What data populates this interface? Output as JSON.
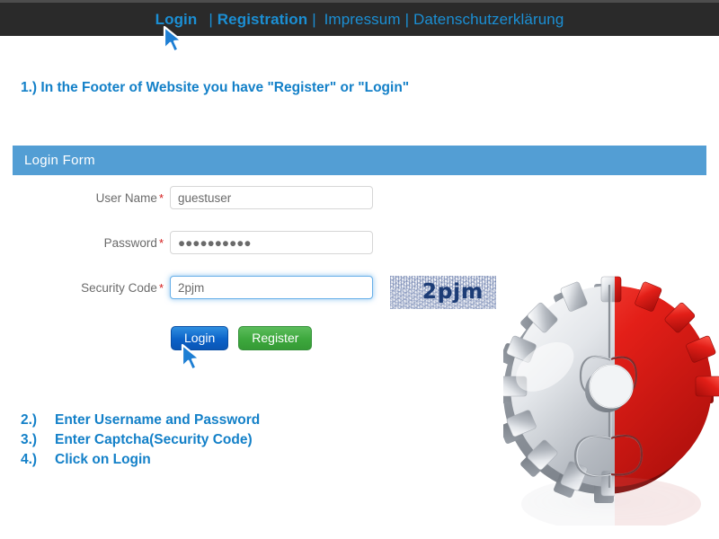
{
  "nav": {
    "items": [
      {
        "label": "Login",
        "bold": true
      },
      {
        "label": "Registration",
        "bold": true
      },
      {
        "label": "Impressum",
        "bold": false
      },
      {
        "label": "Datenschutzerklärung",
        "bold": false
      }
    ],
    "separator": "|",
    "link_color": "#1b8fd4",
    "bar_color": "#2a2a2a"
  },
  "instructions": {
    "step1": "1.) In the Footer of Website you have \"Register\" or \"Login\"",
    "steps": [
      {
        "num": "2.)",
        "text": "Enter Username and Password"
      },
      {
        "num": "3.)",
        "text": "Enter Captcha(Security Code)"
      },
      {
        "num": "4.)",
        "text": "Click on Login"
      }
    ],
    "color": "#1380c8"
  },
  "form": {
    "header_title": "Login Form",
    "header_color": "#539ed4",
    "required_marker": "*",
    "fields": {
      "username": {
        "label": "User Name",
        "value": "guestuser",
        "placeholder": "User Name"
      },
      "password": {
        "label": "Password",
        "value": "●●●●●●●●●●",
        "placeholder": "Password"
      },
      "security_code": {
        "label": "Security Code",
        "value": "2pjm",
        "placeholder": "Security Code"
      }
    },
    "captcha": {
      "text": "2pjm",
      "text_color": "#1c3c76"
    },
    "buttons": {
      "login": "Login",
      "register": "Register"
    }
  },
  "graphic": {
    "alt": "silver-gear-with-red-puzzle-piece",
    "silver_color": "#c9ccd1",
    "red_color": "#e0211c"
  },
  "cursors": {
    "color": "#1e7fd4",
    "nav_label": "pointer-over-login-nav-link",
    "button_label": "pointer-over-login-button"
  }
}
